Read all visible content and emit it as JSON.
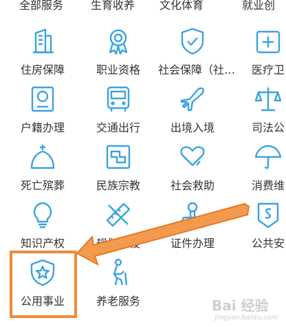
{
  "top_row": [
    "全部服务",
    "生育收养",
    "文化体育",
    "就业创"
  ],
  "rows": [
    [
      {
        "label": "住房保障",
        "icon": "housing-icon"
      },
      {
        "label": "职业资格",
        "icon": "certificate-icon"
      },
      {
        "label": "社会保障（社…",
        "icon": "shield-check-icon"
      },
      {
        "label": "医疗卫",
        "icon": "medical-icon"
      }
    ],
    [
      {
        "label": "户籍办理",
        "icon": "household-icon"
      },
      {
        "label": "交通出行",
        "icon": "bus-icon"
      },
      {
        "label": "出境入境",
        "icon": "airplane-icon"
      },
      {
        "label": "司法公",
        "icon": "scales-icon"
      }
    ],
    [
      {
        "label": "死亡殡葬",
        "icon": "funeral-icon"
      },
      {
        "label": "民族宗教",
        "icon": "religion-icon"
      },
      {
        "label": "社会救助",
        "icon": "heart-hand-icon"
      },
      {
        "label": "消费维",
        "icon": "umbrella-icon"
      }
    ],
    [
      {
        "label": "知识产权",
        "icon": "lightbulb-icon"
      },
      {
        "label": "规划建设",
        "icon": "ruler-pencil-icon"
      },
      {
        "label": "证件办理",
        "icon": "stamp-icon"
      },
      {
        "label": "公共安",
        "icon": "public-safety-icon"
      }
    ],
    [
      {
        "label": "公用事业",
        "icon": "shield-star-icon"
      },
      {
        "label": "养老服务",
        "icon": "elderly-walking-icon"
      }
    ]
  ],
  "watermark": {
    "text": "Bai 经验",
    "sub": "jingyan.baidu.com"
  },
  "colors": {
    "icon": "#3aa3e0",
    "highlight": "#f08a3a",
    "text": "#333333"
  }
}
